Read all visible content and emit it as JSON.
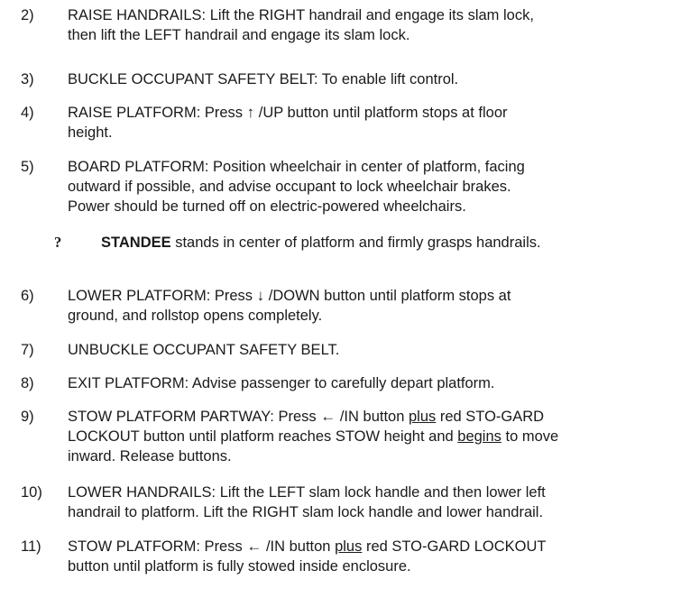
{
  "steps": {
    "s2": {
      "num": "2)",
      "line1": "RAISE HANDRAILS: Lift the RIGHT handrail and engage its slam lock,",
      "line2": "then lift the LEFT handrail and engage its slam lock."
    },
    "s3": {
      "num": "3)",
      "line1": "BUCKLE OCCUPANT SAFETY BELT: To enable lift control."
    },
    "s4": {
      "num": "4)",
      "pre": "RAISE PLATFORM: Press",
      "arrow": "↑",
      "post": "/UP button until platform stops at floor",
      "line2": "height."
    },
    "s5": {
      "num": "5)",
      "line1": "BOARD PLATFORM: Position wheelchair in center of platform, facing",
      "line2": "outward if possible, and advise occupant to lock wheelchair brakes.",
      "line3": "Power should be turned off on electric-powered wheelchairs."
    },
    "bullet": {
      "mark": "?",
      "strong": "STANDEE",
      "rest": " stands in center of platform and firmly grasps handrails."
    },
    "s6": {
      "num": "6)",
      "pre": "LOWER PLATFORM: Press",
      "arrow": "↓",
      "post": "/DOWN button until platform stops at",
      "line2": "ground, and rollstop opens completely."
    },
    "s7": {
      "num": "7)",
      "line1": "UNBUCKLE OCCUPANT SAFETY BELT."
    },
    "s8": {
      "num": "8)",
      "line1": "EXIT PLATFORM: Advise passenger to carefully depart platform."
    },
    "s9": {
      "num": "9)",
      "pre": "STOW PLATFORM PARTWAY: Press",
      "arrow": "←",
      "mid": "/IN button",
      "plus": "plus",
      "post": "red STO-GARD",
      "line2a": "LOCKOUT button until platform reaches STOW height and",
      "begins": "begins",
      "line2b": "to move",
      "line3": "inward. Release buttons."
    },
    "s10": {
      "num": "10)",
      "line1": "LOWER HANDRAILS: Lift the LEFT slam lock handle and then lower left",
      "line2": "handrail to platform. Lift the RIGHT slam lock handle and lower handrail."
    },
    "s11": {
      "num": "11)",
      "pre": "STOW PLATFORM: Press",
      "arrow": "←",
      "mid": "/IN button",
      "plus": "plus",
      "post": "red STO-GARD LOCKOUT",
      "line2": "button until platform is fully stowed inside enclosure."
    }
  }
}
